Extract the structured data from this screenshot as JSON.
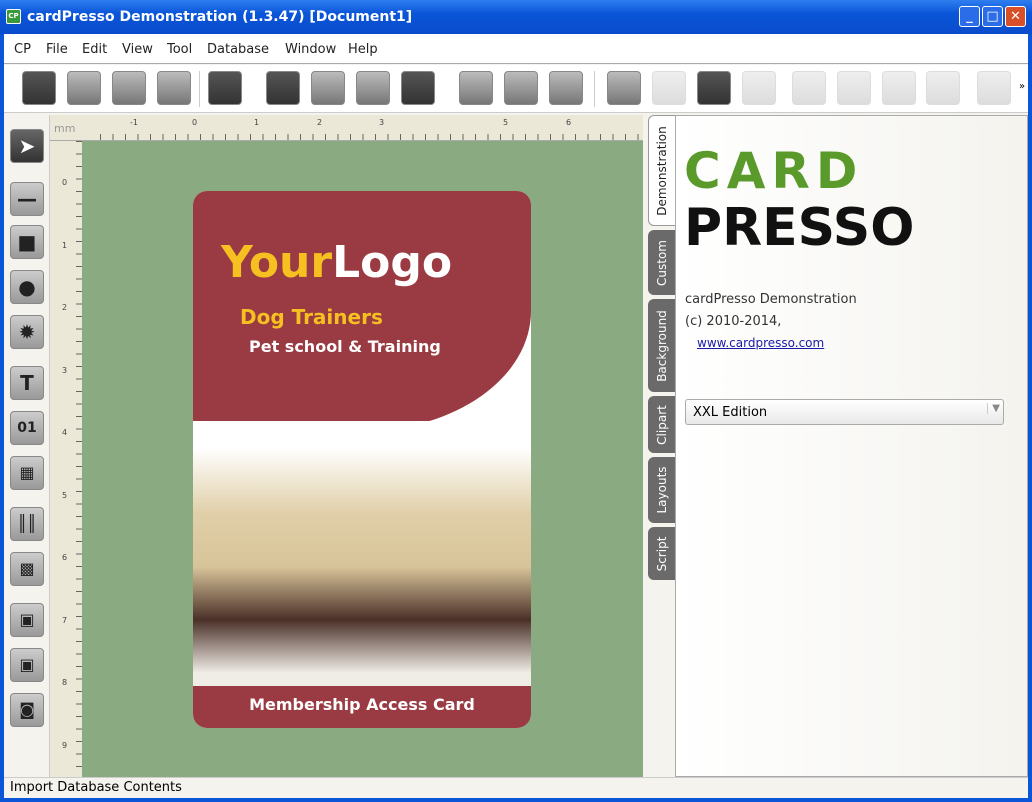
{
  "window": {
    "title": "cardPresso Demonstration (1.3.47) [Document1]",
    "icon": "CP"
  },
  "menu": [
    "CP",
    "File",
    "Edit",
    "View",
    "Tool",
    "Database",
    "Window",
    "Help"
  ],
  "ruler": {
    "unit": "mm",
    "top_ticks": [
      "-1",
      "0",
      "1",
      "2",
      "3",
      "5",
      "6"
    ],
    "left_ticks": [
      "0",
      "1",
      "2",
      "3",
      "4",
      "5",
      "6",
      "7",
      "8",
      "9"
    ]
  },
  "card": {
    "logo_part1": "Your",
    "logo_part2": "Logo",
    "line1": "Dog Trainers",
    "line2": "Pet school & Training",
    "footer": "Membership Access Card",
    "colors": {
      "maroon": "#9a3a42",
      "gold": "#f5c020"
    }
  },
  "tabs": [
    "Demonstration",
    "Custom",
    "Background",
    "Clipart",
    "Layouts",
    "Script"
  ],
  "panel": {
    "brand_top": "CARD",
    "brand_bottom": "PRESSO",
    "line1": "cardPresso Demonstration",
    "line2": "(c) 2010-2014,",
    "link": "www.cardpresso.com",
    "edition": "XXL Edition"
  },
  "status": "Import Database Contents",
  "colors": {
    "canvas": "#8aab82",
    "brand_green": "#5a9a2a"
  }
}
